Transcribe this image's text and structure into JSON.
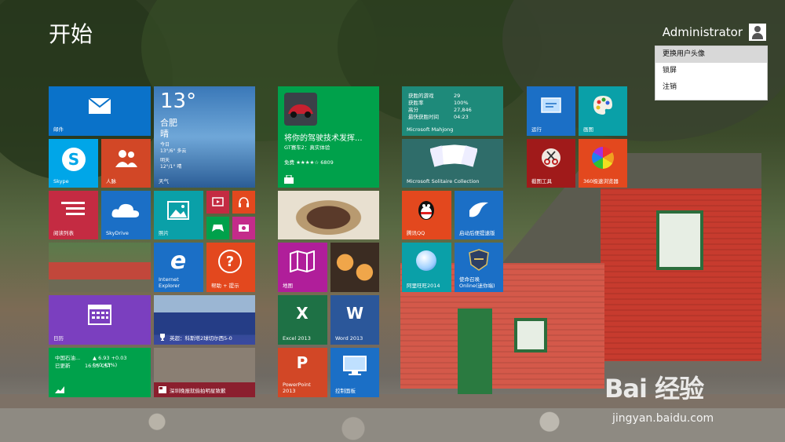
{
  "start_title": "开始",
  "user": {
    "name": "Administrator"
  },
  "user_menu": [
    "更换用户头像",
    "锁屏",
    "注销"
  ],
  "tiles": {
    "mail": "邮件",
    "weather": {
      "temp": "13°",
      "city": "合肥",
      "cond": "晴",
      "today_label": "今日",
      "today": "13°/6° 多云",
      "tomorrow_label": "明天",
      "tomorrow": "12°/1° 晴",
      "label": "天气"
    },
    "skype": "Skype",
    "people": "人脉",
    "reading": "阅读列表",
    "skydrive": "SkyDrive",
    "photos": "照片",
    "ie": "Internet Explorer",
    "help": "帮助 + 提示",
    "calendar": "日历",
    "sports": "英超：科斯塔2球切尔西5-0",
    "finance": {
      "name": "中国石油...",
      "value": "▲ 6.93 +0.03 (+0.43%)",
      "status": "已更新",
      "time": "16:55 CST"
    },
    "news": "深圳晚报就偷拍明星致歉",
    "store": {
      "headline": "将你的驾驶技术发挥...",
      "game": "GT赛车2：真实体验",
      "rating": "免费 ★★★★☆ 6809"
    },
    "maps": "地图",
    "excel": "Excel 2013",
    "word": "Word 2013",
    "powerpoint": "PowerPoint 2013",
    "control": "控制面板",
    "mahjong": {
      "rows": [
        [
          "获胜的游戏",
          "29"
        ],
        [
          "获胜率",
          "100%"
        ],
        [
          "高分",
          "27,846"
        ],
        [
          "最快获胜时间",
          "04:23"
        ]
      ],
      "label": "Microsoft Mahjong"
    },
    "solitaire": "Microsoft Solitaire Collection",
    "qq": "腾讯QQ",
    "speedup": "启动后便提速版",
    "wangwang": "阿里旺旺2014",
    "online": "使命召唤Online(迷你端)",
    "run": "运行",
    "paint": "画图",
    "snip": "截图工具",
    "browser360": "360极速浏览器"
  },
  "watermark": {
    "brand": "Bai 经验",
    "url": "jingyan.baidu.com"
  }
}
